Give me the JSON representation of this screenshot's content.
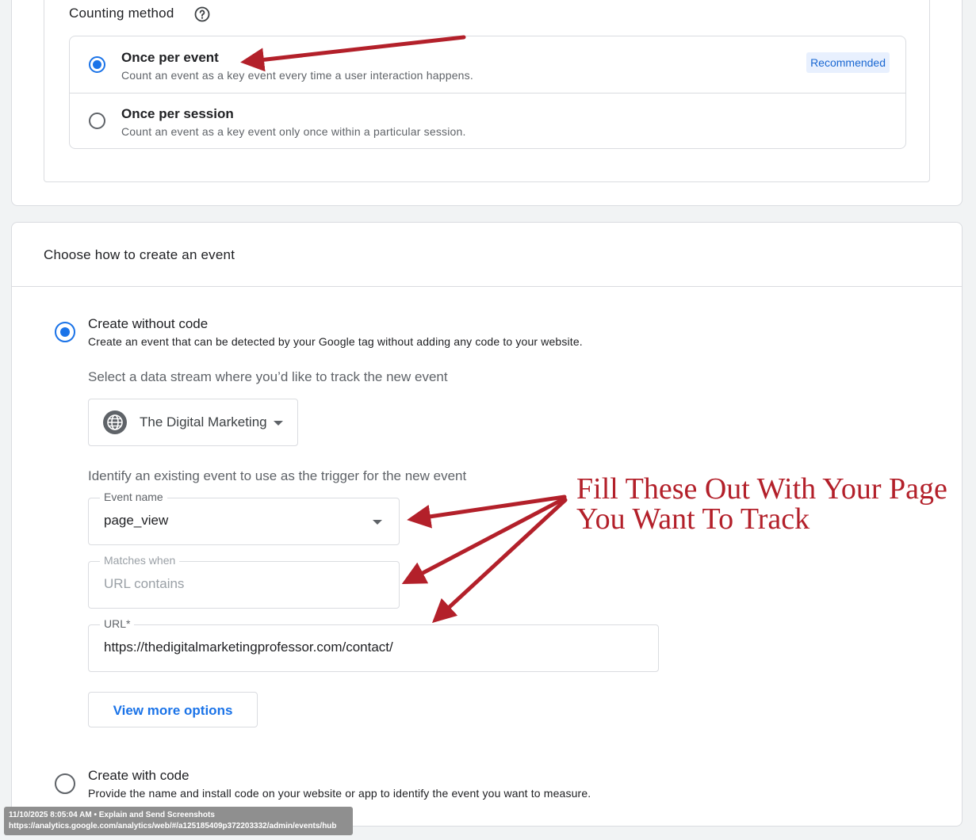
{
  "counting": {
    "title": "Counting method",
    "help_icon": "help-circle-icon",
    "options": [
      {
        "title": "Once per event",
        "description": "Count an event as a key event every time a user interaction happens.",
        "selected": true,
        "badge": "Recommended"
      },
      {
        "title": "Once per session",
        "description": "Count an event as a key event only once within a particular session.",
        "selected": false
      }
    ]
  },
  "create": {
    "title": "Choose how to create an event",
    "without_code": {
      "label": "Create without code",
      "description": "Create an event that can be detected by your Google tag without adding any code to your website.",
      "selected": true,
      "stream_prompt": "Select a data stream where you’d like to track the new event",
      "stream_icon": "globe-icon",
      "stream_value": "The Digital Marketing",
      "trigger_prompt": "Identify an existing event to use as the trigger for the new event",
      "event_name_label": "Event name",
      "event_name_value": "page_view",
      "matches_label": "Matches when",
      "matches_value": "URL contains",
      "url_label": "URL*",
      "url_value": "https://thedigitalmarketingprofessor.com/contact/",
      "more_options": "View more options"
    },
    "with_code": {
      "label": "Create with code",
      "description": "Provide the name and install code on your website or app to identify the event you want to measure.",
      "selected": false
    }
  },
  "annotation": {
    "text": "Fill These Out With Your Page\nYou Want To Track",
    "color": "#b3202a"
  },
  "banner": {
    "line1": "11/10/2025 8:05:04 AM • Explain and Send Screenshots",
    "line2": "https://analytics.google.com/analytics/web/#/a125185409p372203332/admin/events/hub"
  },
  "colors": {
    "accent": "#1a73e8",
    "badge_bg": "#e8f0fe",
    "annotation": "#b3202a"
  }
}
